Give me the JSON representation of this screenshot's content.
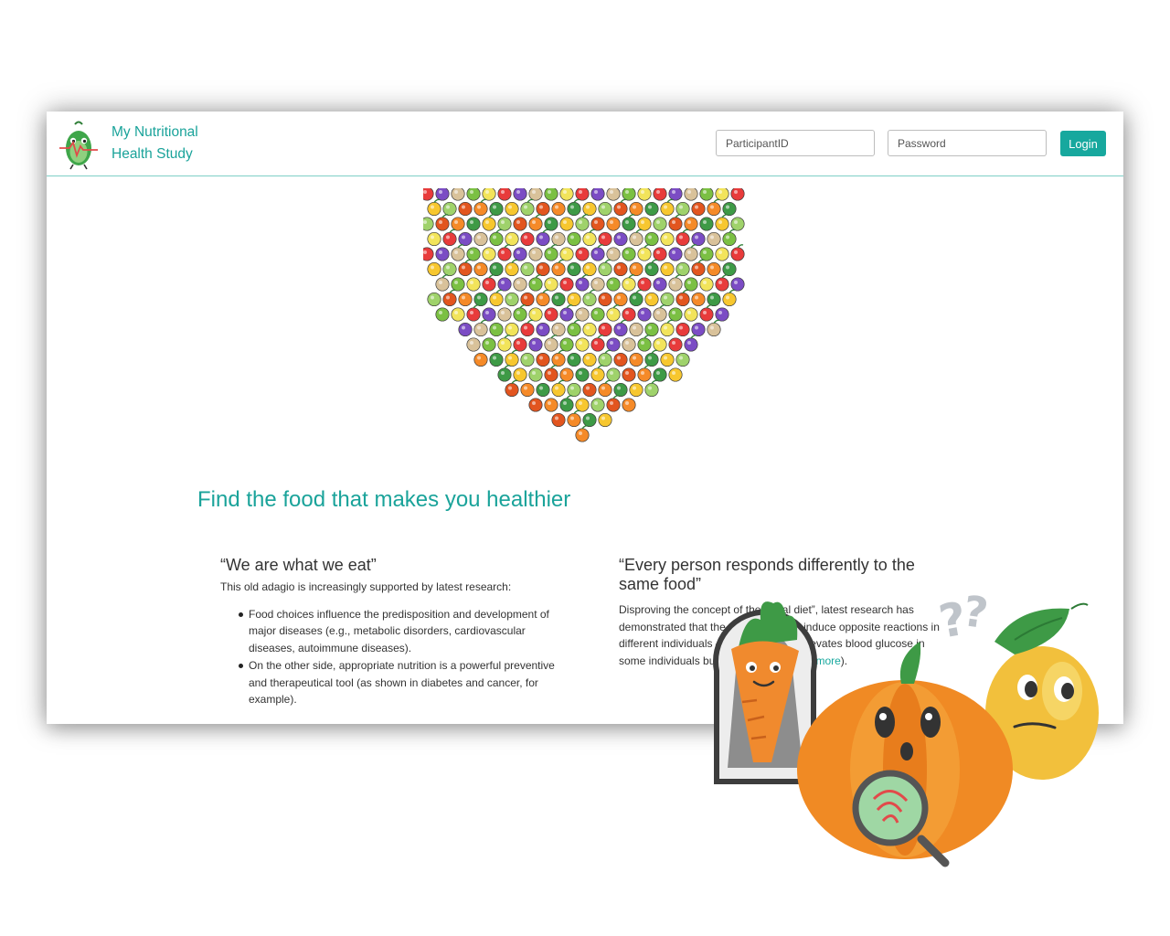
{
  "header": {
    "brand_line1": "My Nutritional",
    "brand_line2": "Health Study",
    "participant_placeholder": "ParticipantID",
    "password_placeholder": "Password",
    "login_label": "Login"
  },
  "hero": {
    "headline": "Find the food that makes you healthier"
  },
  "left_column": {
    "title": "“We are what we eat”",
    "intro": "This old adagio is increasingly supported by latest research:",
    "bullets": [
      "Food choices influence the predisposition and development of major diseases (e.g., metabolic disorders, cardiovascular diseases, autoimmune diseases).",
      "On the other side, appropriate nutrition is a powerful preventive and therapeutical tool (as shown in diabetes and cancer, for example)."
    ]
  },
  "right_column": {
    "title": "“Every person responds differently to the same food”",
    "body": "Disproving the concept of the “ideal diet”, latest research has demonstrated that the same food can induce opposite reactions in different individuals — for example, it elevates blood glucose in some individuals but not in others (",
    "link_text": "learn more",
    "body_end": ")."
  },
  "colors": {
    "accent": "#17a89e",
    "nav_border": "#7fcfc7",
    "text": "#333333"
  },
  "icons": [
    "avocado-mascot-logo",
    "fruit-heart-illustration",
    "carrot-keyhole-icon",
    "pumpkin-magnifier-icon",
    "confused-mango-icon",
    "question-marks-icon"
  ]
}
